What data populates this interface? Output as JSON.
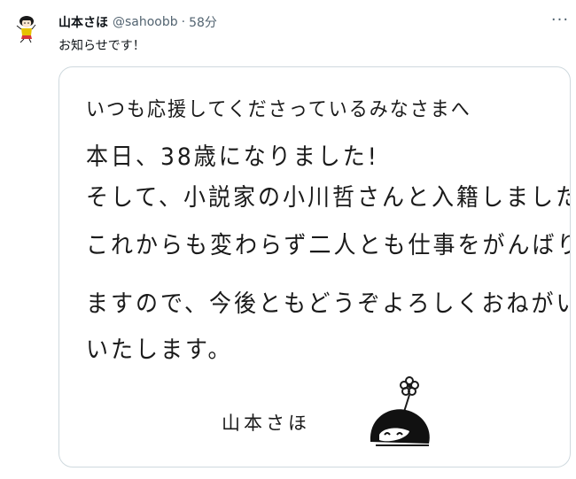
{
  "tweet": {
    "author_name": "山本さほ",
    "handle": "@sahoobb",
    "separator": "·",
    "time": "58分",
    "more_glyph": "···",
    "text": "お知らせです！"
  },
  "media": {
    "lines": [
      "いつも応援してくださっているみなさまへ",
      "本日、38歳になりました!",
      "そして、小説家の小川哲さんと入籍しました!",
      "これからも変わらず二人とも仕事をがんばり",
      "ますので、今後ともどうぞよろしくおねがいい",
      "いたします。"
    ],
    "signature": "山本さほ"
  }
}
